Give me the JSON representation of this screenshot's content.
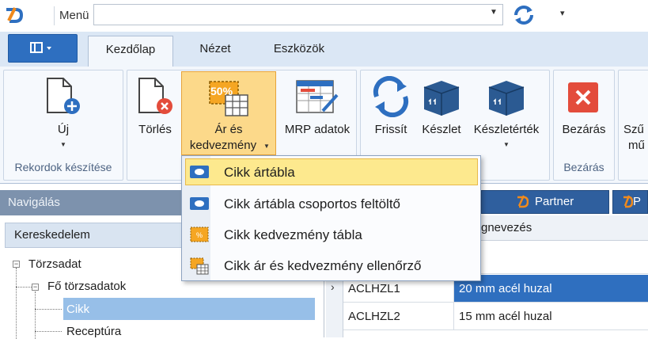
{
  "window": {
    "menu_label": "Menü",
    "menu_value": ""
  },
  "tabs": [
    {
      "label": "Kezdőlap"
    },
    {
      "label": "Nézet"
    },
    {
      "label": "Eszközök"
    }
  ],
  "ribbon": {
    "groups": {
      "new": {
        "label": "Rekordok készítése"
      },
      "close": {
        "label": "Bezárás"
      }
    },
    "buttons": {
      "new": "Új",
      "delete": "Törlés",
      "price_line1": "Ár és",
      "price_line2": "kedvezmény",
      "mrp": "MRP adatok",
      "refresh": "Frissít",
      "stock": "Készlet",
      "stock_value": "Készletérték",
      "close": "Bezárás",
      "partial_top": "Szű",
      "partial_bottom": "mű"
    },
    "price_icon_badge": "50%"
  },
  "dropdown": {
    "items": [
      {
        "label": "Cikk ártábla"
      },
      {
        "label": "Cikk ártábla csoportos feltöltő"
      },
      {
        "label": "Cikk kedvezmény tábla"
      },
      {
        "label": "Cikk ár és kedvezmény ellenőrző"
      }
    ]
  },
  "navigation": {
    "title": "Navigálás",
    "section": "Kereskedelem",
    "tree": [
      {
        "label": "Törzsadat"
      },
      {
        "label": "Fő törzsadatok"
      },
      {
        "label": "Cikk"
      },
      {
        "label": "Receptúra"
      }
    ]
  },
  "grid": {
    "tabs": [
      {
        "label": "Partner"
      },
      {
        "label": "P"
      }
    ],
    "header_partial": "gnevezés",
    "rows": [
      {
        "code": "ACLHZL1",
        "name": "20 mm acél huzal",
        "current_marker": "›"
      },
      {
        "code": "ACLHZL2",
        "name": "15 mm acél huzal"
      }
    ]
  },
  "colors": {
    "accent": "#2e6fc0",
    "highlight": "#fcd98a",
    "close_red": "#e34c3b",
    "selection": "#97bfe8",
    "row_selected": "#2f6fbf"
  }
}
